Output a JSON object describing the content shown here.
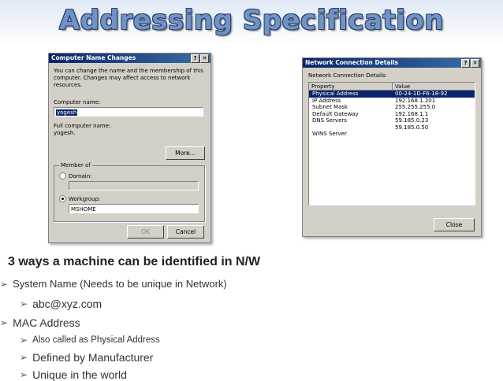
{
  "slide": {
    "title": "Addressing Specification",
    "heading": "3 ways a machine can be identified in N/W",
    "bullets": [
      "System Name (Needs to be unique in Network)",
      "abc@xyz.com",
      "MAC Address",
      "Also called as Physical Address",
      "Defined by Manufacturer",
      "Unique in the world"
    ]
  },
  "computer_dialog": {
    "title": "Computer Name Changes",
    "help": "?",
    "close": "✕",
    "desc": "You can change the name and the membership of this computer. Changes may affect access to network resources.",
    "computer_name_label": "Computer name:",
    "computer_name_value": "yogesh",
    "full_name_label": "Full computer name:",
    "full_name_value": "yogesh.",
    "more_button": "More...",
    "member_of_label": "Member of",
    "domain_label": "Domain:",
    "workgroup_label": "Workgroup:",
    "workgroup_value": "MSHOME",
    "ok_button": "OK",
    "cancel_button": "Cancel"
  },
  "network_dialog": {
    "title": "Network Connection Details",
    "help": "?",
    "close": "✕",
    "subtitle": "Network Connection Details:",
    "columns": [
      "Property",
      "Value"
    ],
    "rows": [
      {
        "property": "Physical Address",
        "value": "00-24-1D-F6-18-92"
      },
      {
        "property": "IP Address",
        "value": "192.168.1.201"
      },
      {
        "property": "Subnet Mask",
        "value": "255.255.255.0"
      },
      {
        "property": "Default Gateway",
        "value": "192.168.1.1"
      },
      {
        "property": "DNS Servers",
        "value": "59.185.0.23"
      },
      {
        "property": "",
        "value": "59.185.0.50"
      },
      {
        "property": "WINS Server",
        "value": ""
      }
    ],
    "close_button": "Close"
  }
}
